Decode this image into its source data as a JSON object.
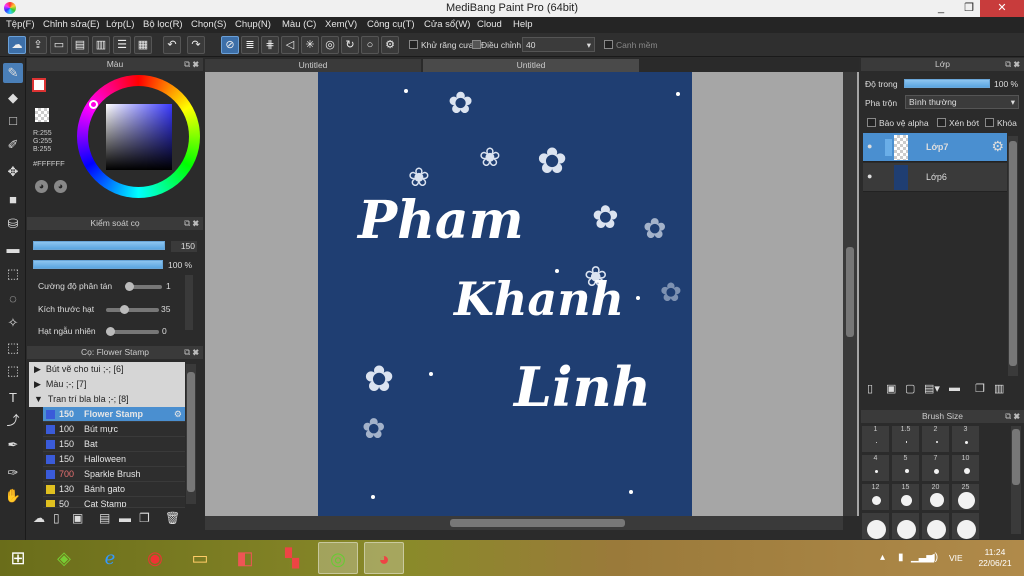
{
  "window": {
    "title": "MediBang Paint Pro (64bit)",
    "min": "_",
    "max": "❐",
    "close": "✕"
  },
  "menu": [
    "Tệp(F)",
    "Chỉnh sửa(E)",
    "Lớp(L)",
    "Bộ lọc(R)",
    "Chọn(S)",
    "Chụp(N)",
    "Màu (C)",
    "Xem(V)",
    "Công cụ(T)",
    "Cửa sổ(W)",
    "Cloud",
    "Help"
  ],
  "toolbar": {
    "antialias": "Khử răng cưa",
    "adjust": "Điều chỉnh",
    "adjust_value": "40",
    "edge": "Canh mềm"
  },
  "color_panel": {
    "title": "Màu",
    "r": "R:255",
    "g": "G:255",
    "b": "B:255",
    "hex": "#FFFFFF"
  },
  "brush_ctrl": {
    "title": "Kiểm soát cọ",
    "size": "150",
    "opacity": "100 %",
    "scatter_label": "Cường độ phân tán",
    "scatter_val": "1",
    "grain_label": "Kích thước hạt",
    "grain_val": "35",
    "random_label": "Hạt ngẫu nhiên",
    "random_val": "0"
  },
  "brush_list": {
    "title": "Cọ: Flower Stamp",
    "groups": [
      "Bút vẽ cho tui ;-; [6]",
      "Màu ;-; [7]",
      "Tran trí bla bla ;-; [8]"
    ],
    "items": [
      {
        "size": "150",
        "name": "Flower Stamp",
        "color": "#3a5bd9"
      },
      {
        "size": "100",
        "name": "Bút mực",
        "color": "#3a5bd9"
      },
      {
        "size": "150",
        "name": "Bat",
        "color": "#3a5bd9"
      },
      {
        "size": "150",
        "name": "Halloween",
        "color": "#3a5bd9"
      },
      {
        "size": "700",
        "name": "Sparkle Brush",
        "color": "#3a5bd9"
      },
      {
        "size": "130",
        "name": "Bánh gato",
        "color": "#e0c020"
      },
      {
        "size": "50",
        "name": "Cat Stamp",
        "color": "#e0c020"
      }
    ]
  },
  "tabs": [
    "Untitled",
    "Untitled"
  ],
  "canvas_text": {
    "line1": "Pham",
    "line2": "Khanh",
    "line3": "Linh"
  },
  "layer_panel": {
    "title": "Lớp",
    "opacity_label": "Độ trong",
    "opacity_val": "100 %",
    "blend_label": "Pha trộn",
    "blend_val": "Bình thường",
    "protect": "Bảo vệ alpha",
    "clip": "Xén bớt",
    "lock": "Khóa",
    "layers": [
      "Lớp7",
      "Lớp6"
    ]
  },
  "brush_size": {
    "title": "Brush Size",
    "labels": [
      "1",
      "1.5",
      "2",
      "3",
      "4",
      "5",
      "7",
      "10",
      "12",
      "15",
      "20",
      "25"
    ]
  },
  "taskbar": {
    "lang": "VIE",
    "time": "11:24",
    "date": "22/06/21"
  },
  "colors": {
    "accent": "#4a8fd0",
    "canvas": "#1f3e72"
  }
}
